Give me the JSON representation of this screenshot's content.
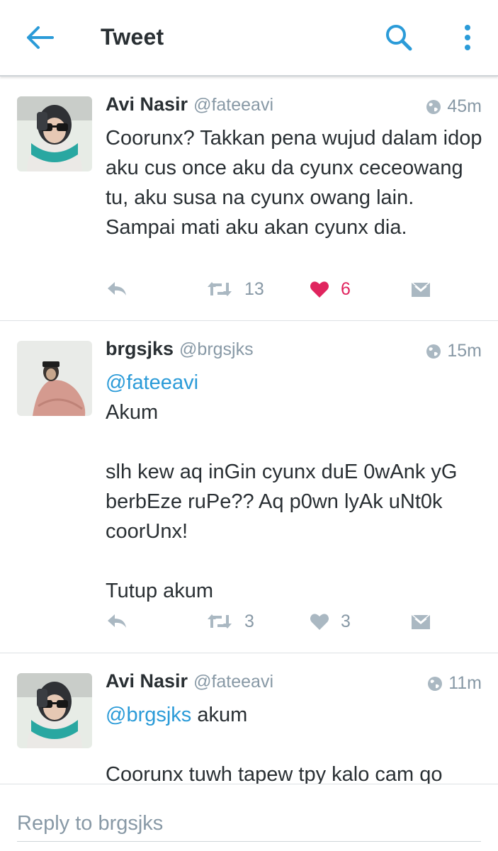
{
  "header": {
    "title": "Tweet",
    "icons": {
      "back": "arrow-left-icon",
      "search": "search-icon",
      "more": "more-vertical-icon"
    },
    "accent_color": "#2b9bd8"
  },
  "tweets": [
    {
      "author_name": "Avi Nasir",
      "handle": "@fateeavi",
      "time": "45m",
      "mention": "",
      "text": "Coorunx? Takkan pena wujud dalam idop aku cus once aku da cyunx ceceowang tu, aku susa na cyunx owang lain. Sampai mati aku akan cyunx dia.",
      "retweets": "13",
      "likes": "6",
      "liked": true
    },
    {
      "author_name": "brgsjks",
      "handle": "@brgsjks",
      "time": "15m",
      "mention": "@fateeavi",
      "text": "Akum\n\nslh kew aq inGin cyunx duE 0wAnk yG berbEze ruPe?? Aq p0wn lyAk uNt0k coorUnx!\n\nTutup akum",
      "retweets": "3",
      "likes": "3",
      "liked": false
    },
    {
      "author_name": "Avi Nasir",
      "handle": "@fateeavi",
      "time": "11m",
      "mention": "@brgsjks",
      "text": " akum\n\nCoorunx tuwh tapew tpy kalo cam qo"
    }
  ],
  "reply": {
    "placeholder": "Reply to brgsjks"
  },
  "colors": {
    "like_active": "#e0245e",
    "secondary_text": "#8899a6",
    "link": "#2b9bd8"
  }
}
